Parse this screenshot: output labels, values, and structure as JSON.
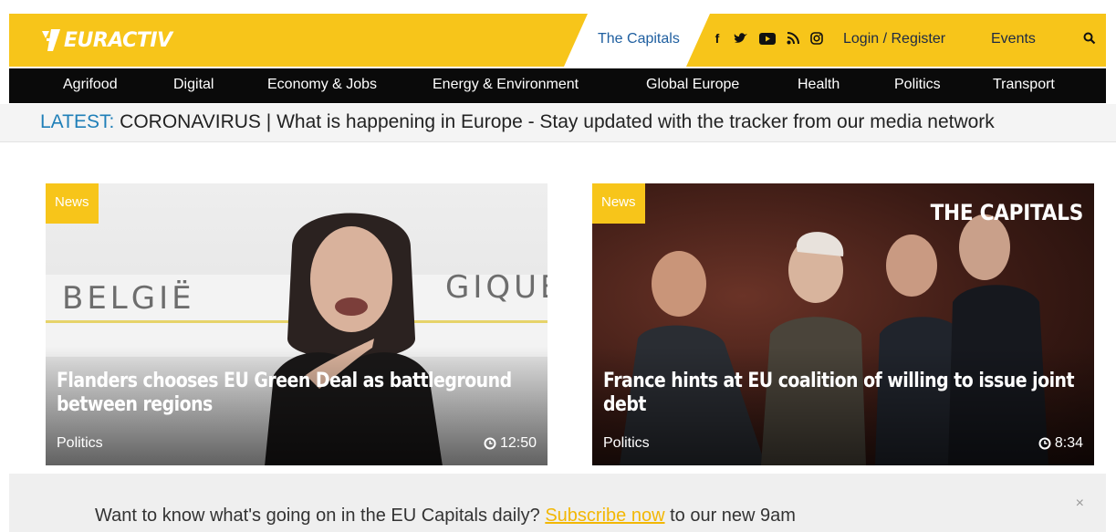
{
  "header": {
    "logo_text": "EURACTIV",
    "capitals_label": "The Capitals",
    "social_icons": [
      "facebook-icon",
      "twitter-icon",
      "youtube-icon",
      "rss-icon",
      "instagram-icon"
    ],
    "login_label": "Login / Register",
    "events_label": "Events",
    "search_icon": "search-icon",
    "brand_color": "#f7c51a"
  },
  "nav": {
    "items": [
      "Agrifood",
      "Digital",
      "Economy & Jobs",
      "Energy & Environment",
      "Global Europe",
      "Health",
      "Politics",
      "Transport"
    ]
  },
  "latest": {
    "label": "LATEST:",
    "text": " CORONAVIRUS | What is happening in Europe - Stay updated with the tracker from our media network"
  },
  "cards": [
    {
      "badge": "News",
      "wall_text_left": "BELGIË",
      "wall_text_right": "GIQUE",
      "title": "Flanders chooses EU Green Deal as battleground between regions",
      "category": "Politics",
      "time": "12:50"
    },
    {
      "badge": "News",
      "overlay_logo": "THE CAPITALS",
      "title": "France hints at EU coalition of willing to issue joint debt",
      "category": "Politics",
      "time": "8:34"
    }
  ],
  "subscribe": {
    "text_before": "Want to know what's going on in the EU Capitals daily? ",
    "link": "Subscribe now",
    "text_after": " to our new 9am",
    "close": "×"
  }
}
